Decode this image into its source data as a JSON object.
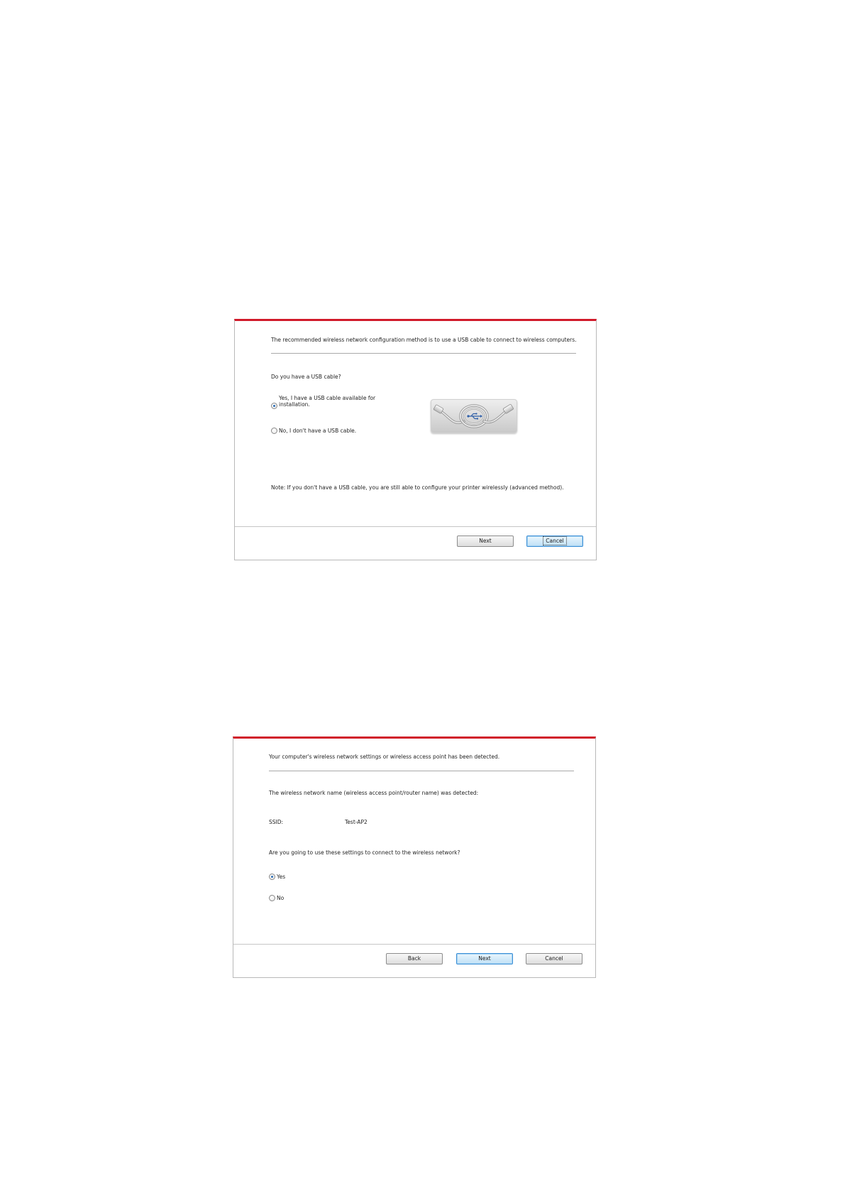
{
  "dialog1": {
    "heading": "The recommended wireless network configuration method is to use a USB cable to connect to wireless computers.",
    "question": "Do you have a USB cable?",
    "options": [
      {
        "label_line1": "Yes, I have a USB cable available for",
        "label_line2": "installation.",
        "selected": true
      },
      {
        "label": "No, I don't have a USB cable.",
        "selected": false
      }
    ],
    "image_icon": "usb-cable-icon",
    "note": "Note:  If you don't have a USB cable, you are still able to configure your printer wirelessly (advanced method).",
    "buttons": {
      "next": "Next",
      "cancel": "Cancel"
    }
  },
  "dialog2": {
    "heading": "Your computer's wireless network settings or wireless access point has been detected.",
    "detected_text": "The wireless network name (wireless access point/router name) was detected:",
    "ssid_label": "SSID:",
    "ssid_value": "Test-AP2",
    "question": "Are you going to use these settings to connect to the wireless network?",
    "options": [
      {
        "label": "Yes",
        "selected": true
      },
      {
        "label": "No",
        "selected": false
      }
    ],
    "buttons": {
      "back": "Back",
      "next": "Next",
      "cancel": "Cancel"
    }
  },
  "colors": {
    "accent": "#d11a2a",
    "radio_dot": "#2f6fb5",
    "default_button_border": "#3c8fd6"
  }
}
